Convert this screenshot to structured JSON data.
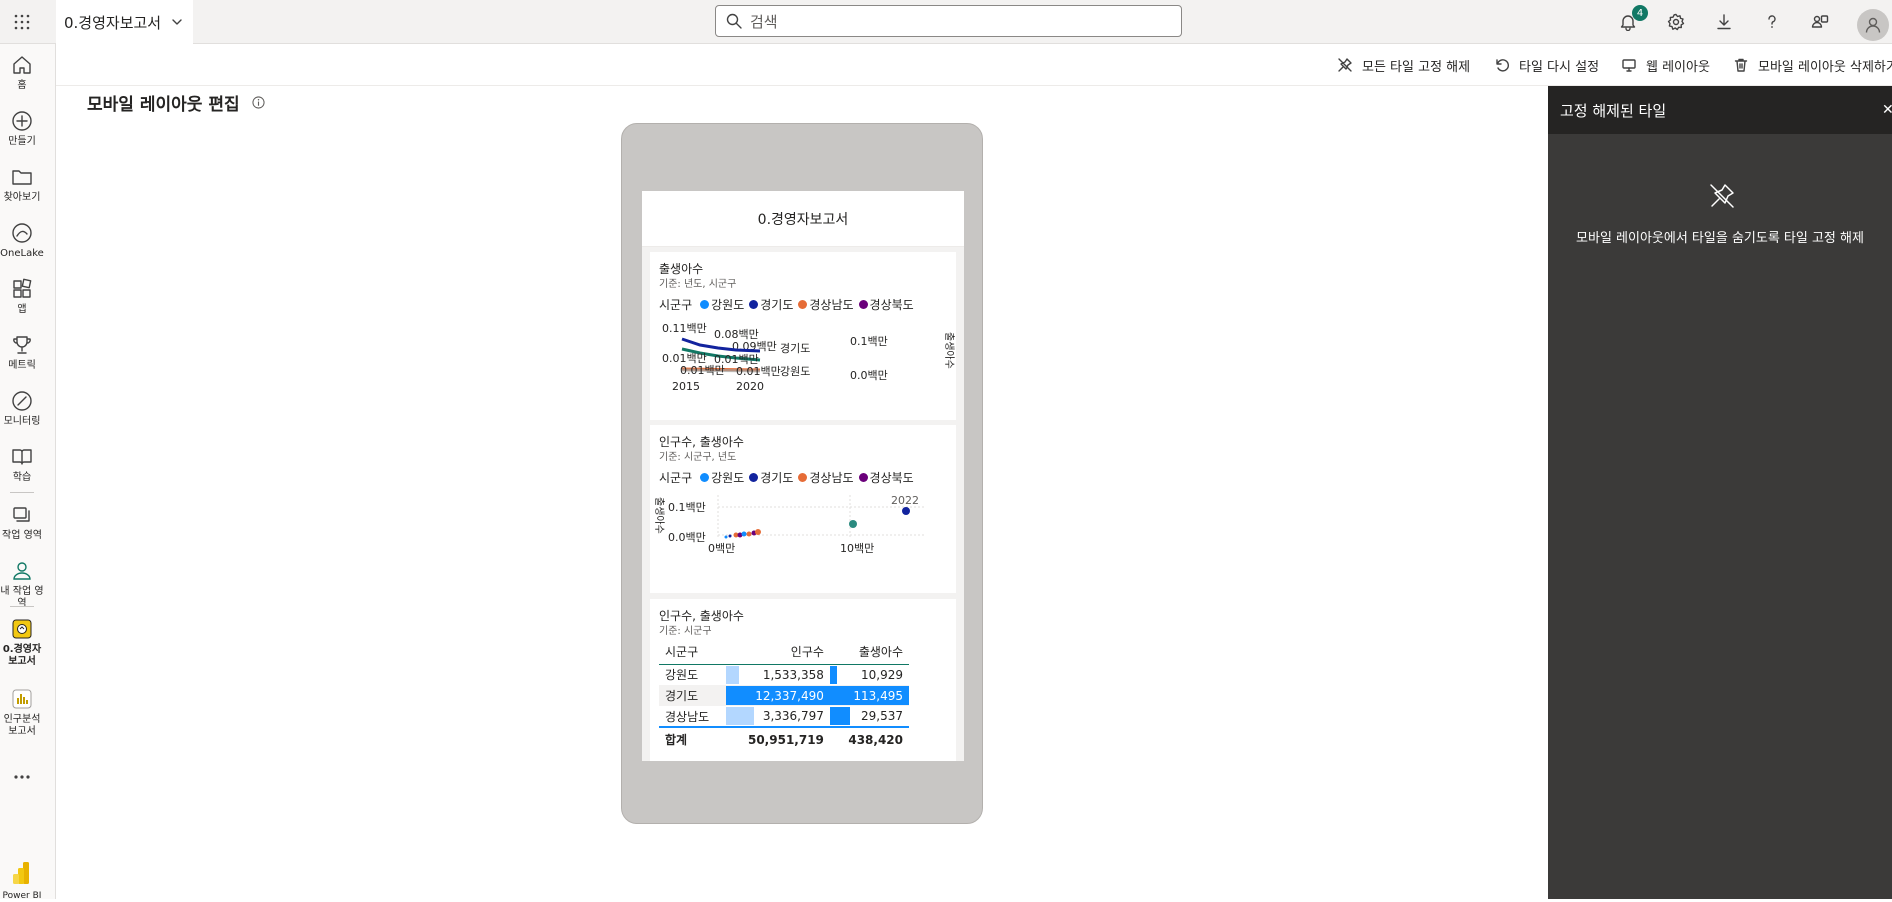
{
  "header": {
    "workspace_title": "0.경영자보고서",
    "search_placeholder": "검색",
    "notification_count": "4"
  },
  "rail": {
    "items": [
      {
        "label": "홈"
      },
      {
        "label": "만들기"
      },
      {
        "label": "찾아보기"
      },
      {
        "label": "OneLake"
      },
      {
        "label": "앱"
      },
      {
        "label": "메트릭"
      },
      {
        "label": "모니터링"
      },
      {
        "label": "학습"
      },
      {
        "label": "작업 영역"
      },
      {
        "label": "내 작업 영역"
      },
      {
        "label": "0.경영자보고서"
      },
      {
        "label": "인구분석보고서"
      },
      {
        "label": "Power BI"
      }
    ]
  },
  "commands": {
    "unpin_all": "모든 타일 고정 해제",
    "reset_tiles": "타일 다시 설정",
    "web_layout": "웹 레이아웃",
    "delete_mobile_layout": "모바일 레이아웃 삭제하기"
  },
  "page": {
    "title": "모바일 레이아웃 편집"
  },
  "phone": {
    "report_title": "0.경영자보고서",
    "legend_title": "시군구",
    "legend": [
      {
        "name": "강원도",
        "color": "#118dff"
      },
      {
        "name": "경기도",
        "color": "#12239e"
      },
      {
        "name": "경상남도",
        "color": "#e66c37"
      },
      {
        "name": "경상북도",
        "color": "#6b007b"
      }
    ],
    "tile1": {
      "title": "출생아수",
      "subtitle": "기준: 년도, 시군구",
      "y_left_top": "0.11백만",
      "y_left_bottom": "0.01백만",
      "labels": [
        "0.08백만",
        "0.09백만",
        "0.01백만",
        "0.01백만",
        "0.01백만"
      ],
      "x_ticks": [
        "2015",
        "2020"
      ],
      "series_labels": [
        "경기도",
        "강원도"
      ],
      "y_right": [
        "0.1백만",
        "0.0백만"
      ],
      "y_right_title": "출생아수"
    },
    "tile2": {
      "title": "인구수, 출생아수",
      "subtitle": "기준: 시군구, 년도",
      "y_title": "출생아수",
      "y_ticks": [
        "0.1백만",
        "0.0백만"
      ],
      "x_ticks": [
        "0백만",
        "10백만"
      ],
      "year_label": "2022"
    },
    "tile3": {
      "title": "인구수, 출생아수",
      "subtitle": "기준: 시군구",
      "columns": [
        "시군구",
        "인구수",
        "출생아수"
      ],
      "rows": [
        {
          "region": "강원도",
          "population": "1,533,358",
          "births": "10,929",
          "pop_frac": 0.124,
          "birth_frac": 0.096
        },
        {
          "region": "경기도",
          "population": "12,337,490",
          "births": "113,495",
          "pop_frac": 1.0,
          "birth_frac": 1.0
        },
        {
          "region": "경상남도",
          "population": "3,336,797",
          "births": "29,537",
          "pop_frac": 0.27,
          "birth_frac": 0.26
        }
      ],
      "total_label": "합계",
      "total_population": "50,951,719",
      "total_births": "438,420"
    }
  },
  "panel": {
    "title": "고정 해제된 타일",
    "message": "모바일 레이아웃에서 타일을 숨기도록 타일 고정 해제"
  },
  "colors": {
    "accent": "#117865",
    "bar_light": "#b3d7ff",
    "bar_dark": "#118dff",
    "panel_bg": "#3b3a39"
  }
}
